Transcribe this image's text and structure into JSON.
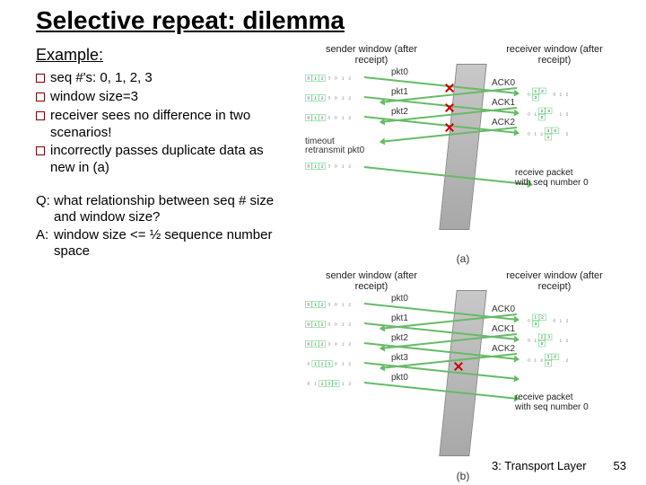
{
  "title": "Selective repeat:\n dilemma",
  "example_label": "Example:",
  "bullets": [
    "seq #'s: 0, 1, 2, 3",
    "window size=3",
    "receiver sees no difference in two scenarios!",
    "incorrectly passes duplicate data as new in (a)"
  ],
  "question": {
    "label": "Q:",
    "text": "what relationship between seq # size and window size?"
  },
  "answer": {
    "label": "A:",
    "text": "window size <= ½ sequence number space"
  },
  "footer": {
    "section": "3: Transport Layer",
    "page": "53"
  },
  "chart_data": [
    {
      "type": "diagram",
      "id": "a",
      "caption": "(a)",
      "headers": {
        "left": "sender window\n(after receipt)",
        "right": "receiver window\n(after receipt)"
      },
      "seq_space": [
        0,
        1,
        2,
        3
      ],
      "window_size": 3,
      "sender_rows": [
        {
          "window": [
            0,
            1,
            2
          ],
          "rest": [
            3,
            0,
            1,
            2
          ],
          "send": "pkt0"
        },
        {
          "window": [
            0,
            1,
            2
          ],
          "rest": [
            3,
            0,
            1,
            2
          ],
          "send": "pkt1"
        },
        {
          "window": [
            0,
            1,
            2
          ],
          "rest": [
            3,
            0,
            1,
            2
          ],
          "send": "pkt2"
        }
      ],
      "timeout": {
        "label": "timeout\nretransmit pkt0",
        "leftrow": {
          "window": [
            0,
            1,
            2
          ],
          "rest": [
            3,
            0,
            1,
            2
          ]
        }
      },
      "receiver_rows": [
        {
          "prefix": [
            0
          ],
          "window": [
            1,
            2,
            3
          ],
          "rest": [
            0,
            1,
            2
          ],
          "ack": "ACK0"
        },
        {
          "prefix": [
            0,
            1
          ],
          "window": [
            2,
            3,
            0
          ],
          "rest": [
            1,
            2
          ],
          "ack": "ACK1"
        },
        {
          "prefix": [
            0,
            1,
            2
          ],
          "window": [
            3,
            0,
            1
          ],
          "rest": [
            2
          ],
          "ack": "ACK2"
        }
      ],
      "acks_lost": [
        "ACK0",
        "ACK1",
        "ACK2"
      ],
      "receiver_note": "receive packet\nwith seq number 0"
    },
    {
      "type": "diagram",
      "id": "b",
      "caption": "(b)",
      "headers": {
        "left": "sender window\n(after receipt)",
        "right": "receiver window\n(after receipt)"
      },
      "seq_space": [
        0,
        1,
        2,
        3
      ],
      "window_size": 3,
      "sender_rows": [
        {
          "window": [
            0,
            1,
            2
          ],
          "rest": [
            3,
            0,
            1,
            2
          ],
          "send": "pkt0"
        },
        {
          "window": [
            0,
            1,
            2
          ],
          "rest": [
            3,
            0,
            1,
            2
          ],
          "send": "pkt1"
        },
        {
          "window": [
            0,
            1,
            2
          ],
          "rest": [
            3,
            0,
            1,
            2
          ],
          "send": "pkt2"
        },
        {
          "prefix": [
            0
          ],
          "window": [
            1,
            2,
            3
          ],
          "rest": [
            0,
            1,
            2
          ],
          "send": "pkt3"
        },
        {
          "prefix": [
            0,
            1
          ],
          "window": [
            2,
            3,
            0
          ],
          "rest": [
            1,
            2
          ],
          "send": "pkt0"
        }
      ],
      "receiver_rows": [
        {
          "prefix": [
            0
          ],
          "window": [
            1,
            2,
            3
          ],
          "rest": [
            0,
            1,
            2
          ],
          "ack": "ACK0"
        },
        {
          "prefix": [
            0,
            1
          ],
          "window": [
            2,
            3,
            0
          ],
          "rest": [
            1,
            2
          ],
          "ack": "ACK1"
        },
        {
          "prefix": [
            0,
            1,
            2
          ],
          "window": [
            3,
            0,
            1
          ],
          "rest": [
            2
          ],
          "ack": "ACK2"
        }
      ],
      "pkt_lost": "pkt3",
      "receiver_note": "receive packet\nwith seq number 0"
    }
  ]
}
